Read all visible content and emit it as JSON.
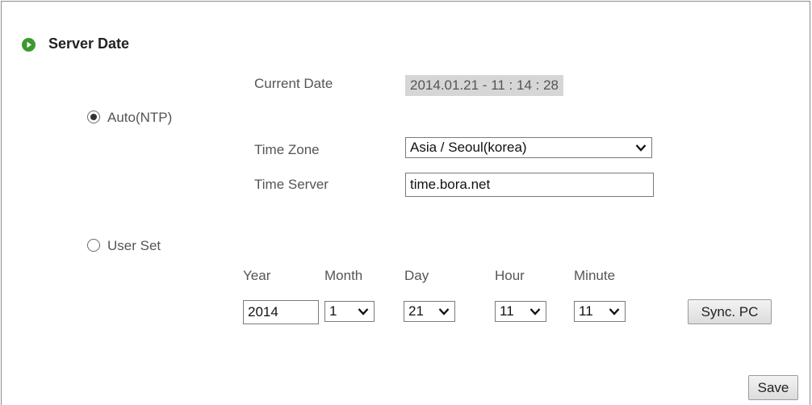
{
  "section": {
    "title": "Server Date",
    "icon": "play-circle-icon",
    "accent": "#3c9a2e"
  },
  "current_date": {
    "label": "Current Date",
    "value": "2014.01.21 - 11 : 14 : 28"
  },
  "mode": {
    "auto": {
      "label": "Auto(NTP)",
      "selected": true
    },
    "user": {
      "label": "User Set",
      "selected": false
    }
  },
  "ntp": {
    "timezone_label": "Time Zone",
    "timezone_value": "Asia / Seoul(korea)",
    "server_label": "Time Server",
    "server_value": "time.bora.net"
  },
  "user_set": {
    "year_label": "Year",
    "month_label": "Month",
    "day_label": "Day",
    "hour_label": "Hour",
    "minute_label": "Minute",
    "year_value": "2014",
    "month_value": "1",
    "day_value": "21",
    "hour_value": "11",
    "minute_value": "11",
    "sync_label": "Sync. PC"
  },
  "actions": {
    "save_label": "Save"
  }
}
